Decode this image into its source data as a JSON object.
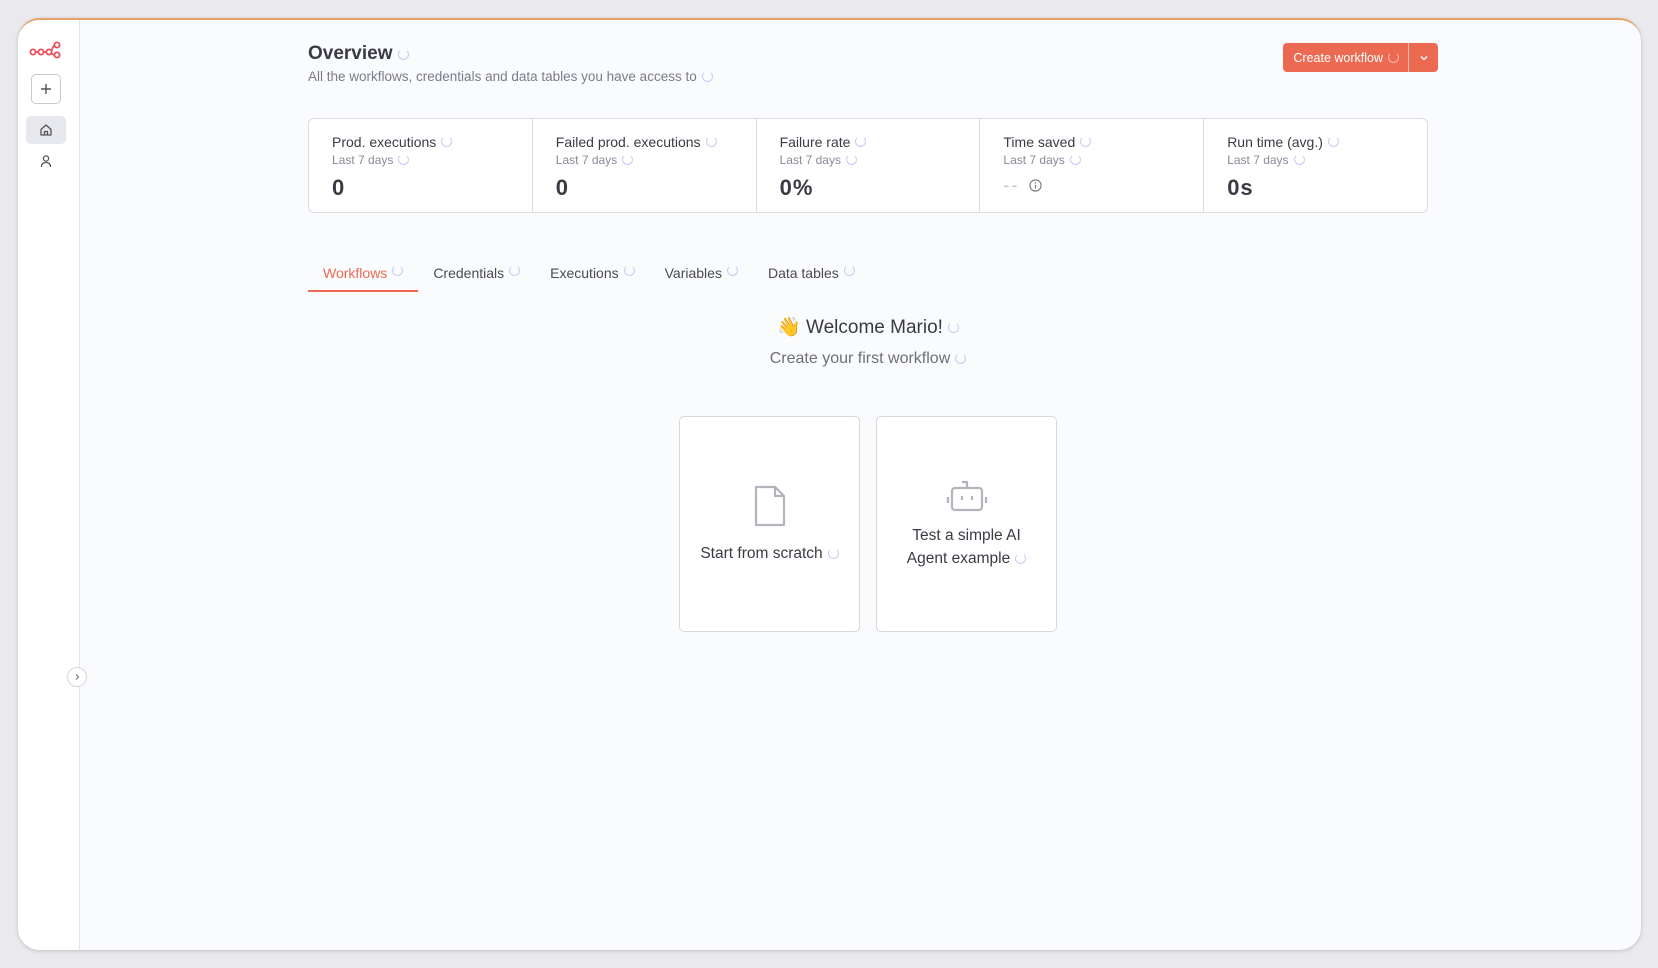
{
  "sidebar": {
    "logo_icon": "n8n-logo-icon",
    "new_icon": "plus-icon",
    "home_icon": "home-icon",
    "user_icon": "user-icon",
    "collapse_icon": "chevron-right-icon"
  },
  "header": {
    "title": "Overview",
    "subtitle": "All the workflows, credentials and data tables you have access to",
    "create_label": "Create workflow",
    "dropdown_icon": "chevron-down-icon"
  },
  "stats": [
    {
      "label": "Prod. executions",
      "period": "Last 7 days",
      "value": "0"
    },
    {
      "label": "Failed prod. executions",
      "period": "Last 7 days",
      "value": "0"
    },
    {
      "label": "Failure rate",
      "period": "Last 7 days",
      "value": "0%"
    },
    {
      "label": "Time saved",
      "period": "Last 7 days",
      "value": "--"
    },
    {
      "label": "Run time (avg.)",
      "period": "Last 7 days",
      "value": "0s"
    }
  ],
  "tabs": [
    {
      "label": "Workflows",
      "active": true
    },
    {
      "label": "Credentials"
    },
    {
      "label": "Executions"
    },
    {
      "label": "Variables"
    },
    {
      "label": "Data tables"
    }
  ],
  "welcome": {
    "emoji": "👋",
    "title": "Welcome Mario!",
    "subtitle": "Create your first workflow"
  },
  "cards": [
    {
      "label": "Start from scratch",
      "icon": "file-icon"
    },
    {
      "label": "Test a simple AI Agent example",
      "icon": "robot-icon"
    }
  ],
  "colors": {
    "accent": "#ec6a52",
    "spinner": "#c6ccf2"
  }
}
